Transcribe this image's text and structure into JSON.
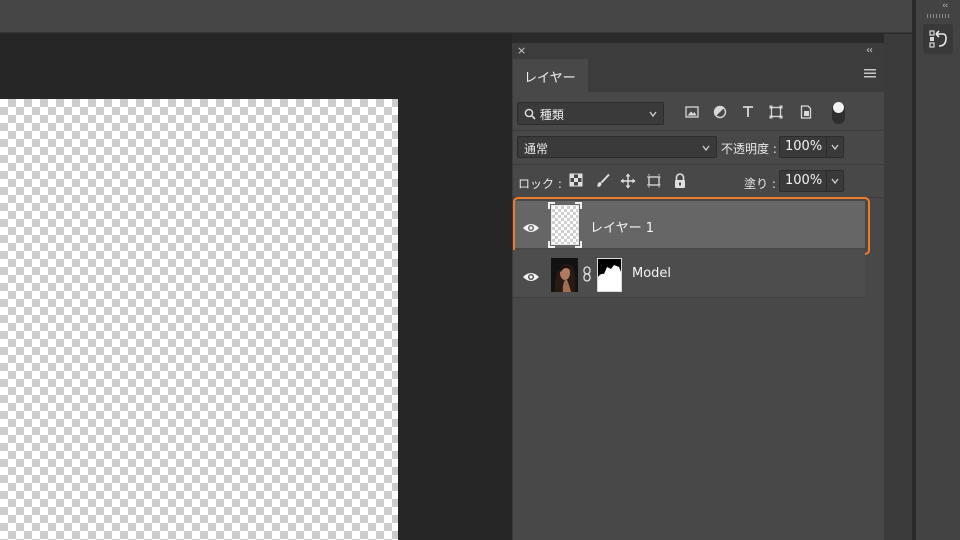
{
  "panel": {
    "close_glyph": "×",
    "collapse_glyph": "‹‹",
    "tab_label": "レイヤー",
    "menu_icon": "panel-menu-icon"
  },
  "filter": {
    "kind_label": "種類",
    "icons": [
      "image-filter-icon",
      "adjustment-filter-icon",
      "type-filter-icon",
      "shape-filter-icon",
      "smart-object-filter-icon"
    ],
    "toggle_state": "on"
  },
  "blend": {
    "mode": "通常",
    "opacity_label": "不透明度 :",
    "opacity_value": "100%"
  },
  "lock": {
    "label": "ロック :",
    "icons": [
      "lock-transparent-pixels-icon",
      "lock-image-pixels-icon",
      "lock-position-icon",
      "prevent-auto-nesting-icon",
      "lock-all-icon"
    ],
    "fill_label": "塗り :",
    "fill_value": "100%"
  },
  "layers": [
    {
      "name": "レイヤー 1",
      "visible": true,
      "selected": true
    },
    {
      "name": "Model",
      "visible": true,
      "selected": false,
      "has_mask": true
    }
  ],
  "dock": {
    "collapse_glyph": "‹‹",
    "history_icon": "history-icon"
  },
  "colors": {
    "selection_outline": "#ef7a2a",
    "selected_layer_bg": "#666666",
    "panel_bg": "#484848"
  }
}
